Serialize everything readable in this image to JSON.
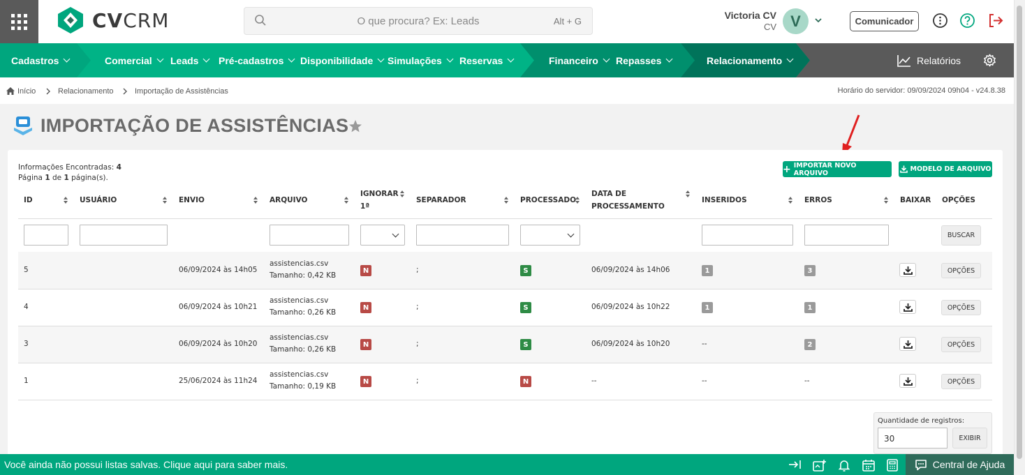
{
  "header": {
    "logo_brand": "CV",
    "logo_suffix": "CRM",
    "search_placeholder": "O que procura? Ex: Leads",
    "search_shortcut": "Alt + G",
    "user_name": "Victoria CV",
    "user_role": "CV",
    "avatar_letter": "V",
    "communicator_label": "Comunicador"
  },
  "nav": {
    "items": [
      {
        "label": "Cadastros"
      },
      {
        "label": "Comercial"
      },
      {
        "label": "Leads"
      },
      {
        "label": "Pré-cadastros"
      },
      {
        "label": "Disponibilidade"
      },
      {
        "label": "Simulações"
      },
      {
        "label": "Reservas"
      },
      {
        "label": "Financeiro"
      },
      {
        "label": "Repasses"
      },
      {
        "label": "Relacionamento"
      }
    ],
    "reports_label": "Relatórios"
  },
  "breadcrumb": {
    "home": "Início",
    "section": "Relacionamento",
    "current": "Importação de Assistências",
    "server_time": "Horário do servidor: 09/09/2024 09h04 - v24.8.38"
  },
  "page": {
    "title": "IMPORTAÇÃO DE ASSISTÊNCIAS"
  },
  "summary": {
    "found_label": "Informações Encontradas:",
    "found_count": "4",
    "page_word": "Página",
    "page_current": "1",
    "page_of": "de",
    "page_total": "1",
    "page_suffix": "página(s)."
  },
  "actions": {
    "import_label": "IMPORTAR NOVO ARQUIVO",
    "template_label": "MODELO DE ARQUIVO"
  },
  "table": {
    "headers": {
      "id": "ID",
      "usuario": "USUÁRIO",
      "envio": "ENVIO",
      "arquivo": "ARQUIVO",
      "ignorar_1": "IGNORAR",
      "ignorar_2": "1ª",
      "separador": "SEPARADOR",
      "processado": "PROCESSADO",
      "data_1": "DATA DE",
      "data_2": "PROCESSAMENTO",
      "inseridos": "INSERIDOS",
      "erros": "ERROS",
      "baixar": "BAIXAR",
      "opcoes": "OPÇÕES"
    },
    "search_button": "BUSCAR",
    "rows": [
      {
        "id": "5",
        "usuario": "",
        "envio": "06/09/2024 às 14h05",
        "arquivo": "assistencias.csv",
        "tamanho": "Tamanho: 0,42 KB",
        "ignorar": "N",
        "separador": ";",
        "processado": "S",
        "data": "06/09/2024 às 14h06",
        "inseridos": "1",
        "erros": "3",
        "opcoes": "OPÇÕES"
      },
      {
        "id": "4",
        "usuario": "",
        "envio": "06/09/2024 às 10h21",
        "arquivo": "assistencias.csv",
        "tamanho": "Tamanho: 0,26 KB",
        "ignorar": "N",
        "separador": ";",
        "processado": "S",
        "data": "06/09/2024 às 10h22",
        "inseridos": "1",
        "erros": "1",
        "opcoes": "OPÇÕES"
      },
      {
        "id": "3",
        "usuario": "",
        "envio": "06/09/2024 às 10h20",
        "arquivo": "assistencias.csv",
        "tamanho": "Tamanho: 0,26 KB",
        "ignorar": "N",
        "separador": ";",
        "processado": "S",
        "data": "06/09/2024 às 10h20",
        "inseridos": "--",
        "erros": "2",
        "opcoes": "OPÇÕES"
      },
      {
        "id": "1",
        "usuario": "",
        "envio": "25/06/2024 às 11h24",
        "arquivo": "assistencias.csv",
        "tamanho": "Tamanho: 0,19 KB",
        "ignorar": "N",
        "separador": ";",
        "processado": "N",
        "data": "--",
        "inseridos": "--",
        "erros": "--",
        "opcoes": "OPÇÕES"
      }
    ]
  },
  "pagination": {
    "qty_label": "Quantidade de registros:",
    "qty_value": "30",
    "show_button": "EXIBIR"
  },
  "footer": {
    "message": "Você ainda não possui listas salvas. Clique aqui para saber mais.",
    "help_label": "Central de Ajuda"
  },
  "colors": {
    "brand_green": "#00a67e",
    "dark_green": "#2f6b5a",
    "badge_red": "#b84a46",
    "badge_green": "#2e8b45",
    "badge_gray": "#9a9a9a"
  }
}
